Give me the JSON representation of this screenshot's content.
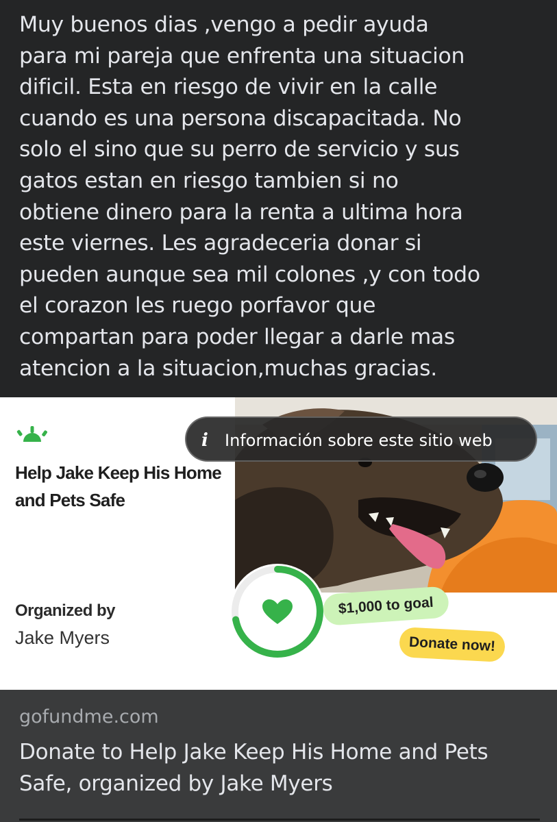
{
  "post": {
    "text": "Muy buenos dias  ,vengo a pedir ayuda\npara mi pareja que enfrenta una situacion\ndificil. Esta en riesgo de vivir en la calle\ncuando es una persona discapacitada. No\nsolo el sino que su perro de servicio y sus\ngatos estan en riesgo tambien si no\nobtiene dinero para la renta  a ultima hora\neste viernes. Les agradeceria donar si\npueden aunque sea mil colones ,y con todo\nel corazon les ruego porfavor que\ncompartan para poder llegar a darle mas\natencion a la situacion,muchas gracias."
  },
  "card": {
    "logo_icon": "gofundme-logo-icon",
    "title": "Help Jake Keep His Home and Pets Safe",
    "organized_label": "Organized by",
    "organizer": "Jake Myers",
    "info_button": "Información sobre este sitio web",
    "info_icon": "i",
    "progress_fraction": 0.72,
    "goal_text": "$1,000 to goal",
    "donate_text": "Donate now!",
    "accent_color": "#36b24a"
  },
  "link": {
    "domain": "gofundme.com",
    "title": "Donate to Help Jake Keep His Home and Pets Safe, organized by Jake Myers"
  }
}
